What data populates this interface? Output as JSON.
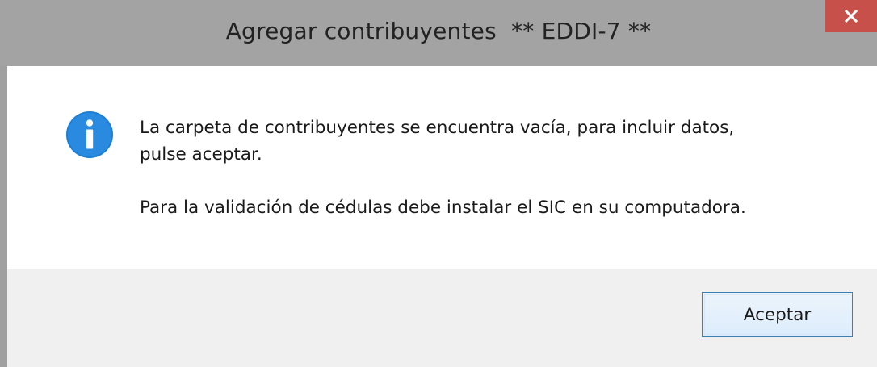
{
  "window": {
    "title": "Agregar contribuyentes  ** EDDI-7 **",
    "close_glyph": "✕",
    "close_color": "#c7504a"
  },
  "dialog": {
    "icon": "info-icon",
    "icon_color": "#1a7fd6",
    "message_line1": "La carpeta de contribuyentes se encuentra vacía, para incluir datos,",
    "message_line2": "pulse aceptar.",
    "message_secondary": "Para la validación de cédulas debe instalar el SIC en su computadora."
  },
  "buttons": {
    "ok_label": "Aceptar"
  }
}
